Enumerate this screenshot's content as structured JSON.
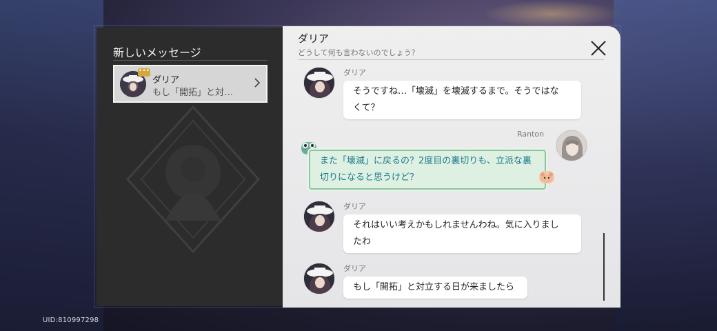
{
  "uid": "UID:810997298",
  "left": {
    "title": "新しいメッセージ",
    "contacts": [
      {
        "name": "ダリア",
        "preview": "もし「開拓」と対…",
        "badge": "•••"
      }
    ]
  },
  "chat": {
    "title": "ダリア",
    "subtitle": "どうして何も言わないのでしょう？",
    "messages": [
      {
        "sender": "ダリア",
        "line1": "そうですね…「壊滅」を壊滅するまで。そうではな",
        "line2": "くて？"
      },
      {
        "sender": "Ranton",
        "line1": "また「壊滅」に戻るの？2度目の裏切りも、立派な裏",
        "line2": "切りになると思うけど？"
      },
      {
        "sender": "ダリア",
        "line1": "それはいい考えかもしれませんわね。気に入りまし",
        "line2": "たわ"
      },
      {
        "sender": "ダリア",
        "line1": "もし「開拓」と対立する日が来ましたら"
      }
    ]
  },
  "colors": {
    "left_panel": "#2c2c2c",
    "right_panel": "#efefef",
    "self_bubble": "#ddf0e2",
    "self_text": "#1d7a8a"
  }
}
